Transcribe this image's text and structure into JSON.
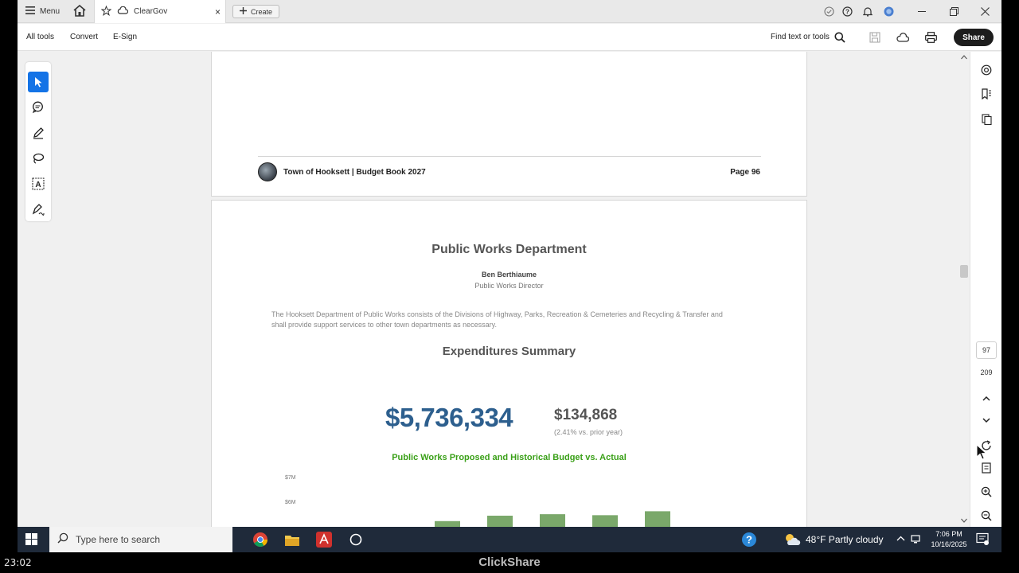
{
  "tabbar": {
    "menu_label": "Menu",
    "tab_title": "ClearGov",
    "tab_close": "×",
    "create_label": "Create"
  },
  "toolbar": {
    "all_tools": "All tools",
    "convert": "Convert",
    "esign": "E-Sign",
    "find_text": "Find text or tools",
    "share": "Share"
  },
  "page96": {
    "footer_title": "Town of Hooksett | Budget Book 2027",
    "footer_page": "Page 96"
  },
  "page97": {
    "dept_title": "Public Works Department",
    "director_name": "Ben Berthiaume",
    "director_role": "Public Works Director",
    "description": "The Hooksett Department of Public Works consists of the Divisions of Highway, Parks, Recreation & Cemeteries and Recycling & Transfer and shall provide support services to other town departments as necessary.",
    "exp_title": "Expenditures Summary",
    "total_amount": "$5,736,334",
    "change_amount": "$134,868",
    "change_note": "(2.41% vs. prior year)",
    "chart_title": "Public Works Proposed and Historical Budget vs. Actual"
  },
  "chart_data": {
    "type": "bar",
    "title": "Public Works Proposed and Historical Budget vs. Actual",
    "ytick_labels": [
      "$7M",
      "$6M"
    ],
    "ylim": [
      0,
      7000000
    ],
    "values": [
      5200000,
      5420000,
      5480000,
      5440000,
      5600000
    ],
    "color": "#7aa86a"
  },
  "viewer": {
    "current_page": "97",
    "total_pages": "209"
  },
  "taskbar": {
    "search_placeholder": "Type here to search",
    "weather": "48°F  Partly cloudy",
    "time": "7:06 PM",
    "date": "10/16/2025"
  },
  "bottom": {
    "timer": "23:02",
    "brand": "ClickShare"
  }
}
